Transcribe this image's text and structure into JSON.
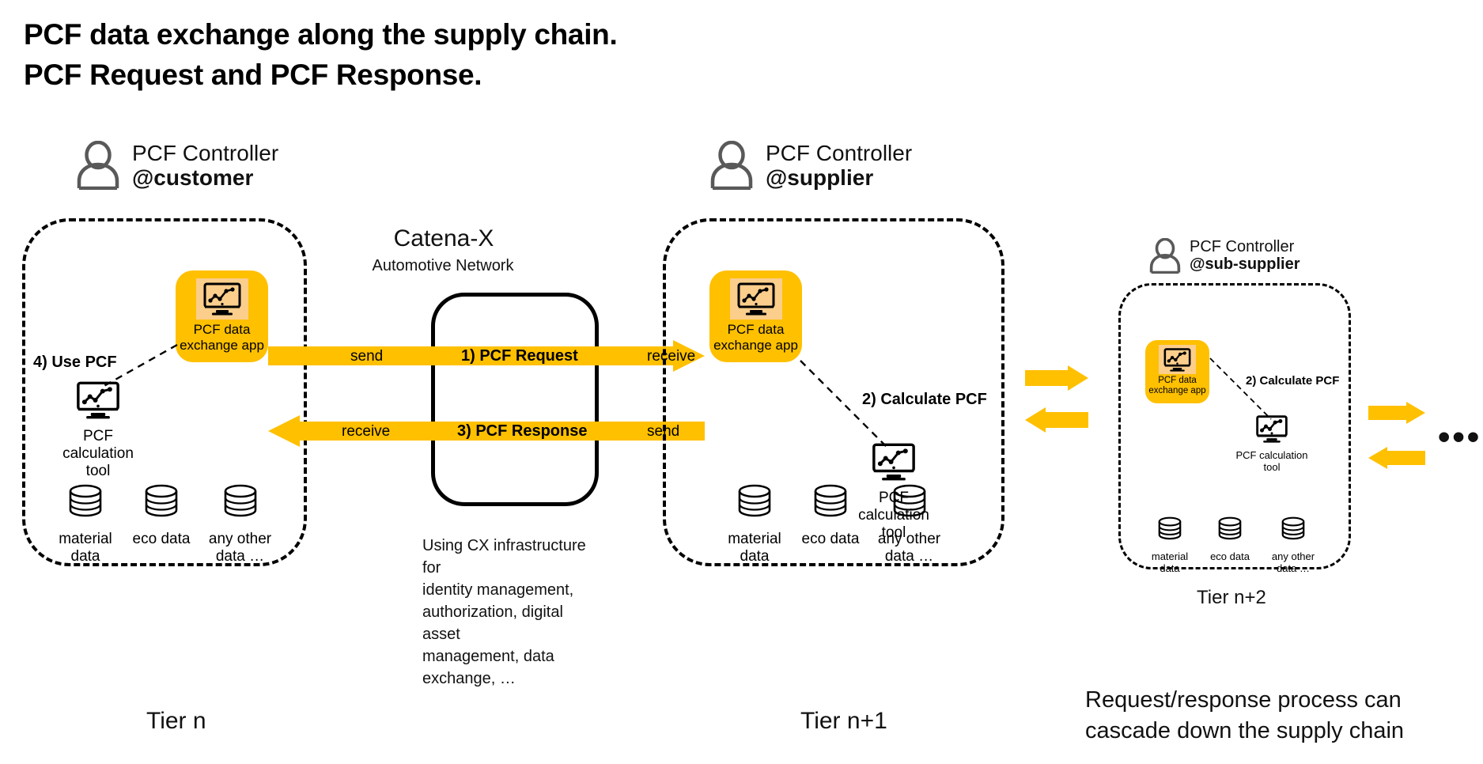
{
  "title": "PCF data exchange along the supply chain.\nPCF Request and PCF Response.",
  "customer": {
    "controller_role": "PCF Controller",
    "controller_handle": "@customer",
    "app": {
      "label": "PCF data\nexchange app",
      "icon": "monitor-chart-icon"
    },
    "calc_tool": {
      "label": "PCF\ncalculation\ntool",
      "icon": "monitor-chart-icon"
    },
    "step_label": "4) Use PCF",
    "databases": [
      {
        "label": "material\ndata",
        "icon": "database-icon"
      },
      {
        "label": "eco data",
        "icon": "database-icon"
      },
      {
        "label": "any other\ndata …",
        "icon": "database-icon"
      }
    ],
    "tier": "Tier n"
  },
  "network": {
    "title": "Catena-X",
    "subtitle": "Automotive Network",
    "note": "Using CX infrastructure for\nidentity management,\nauthorization, digital asset\nmanagement, data\nexchange, …"
  },
  "flows": [
    {
      "from_label": "send",
      "name": "1) PCF Request",
      "to_label": "receive",
      "direction": "right"
    },
    {
      "from_label": "receive",
      "name": "3) PCF Response",
      "to_label": "send",
      "direction": "left"
    }
  ],
  "supplier": {
    "controller_role": "PCF Controller",
    "controller_handle": "@supplier",
    "app": {
      "label": "PCF data\nexchange app",
      "icon": "monitor-chart-icon"
    },
    "calc_tool": {
      "label": "PCF\ncalculation\ntool",
      "icon": "monitor-chart-icon"
    },
    "step_label": "2) Calculate PCF",
    "databases": [
      {
        "label": "material\ndata",
        "icon": "database-icon"
      },
      {
        "label": "eco data",
        "icon": "database-icon"
      },
      {
        "label": "any other\ndata …",
        "icon": "database-icon"
      }
    ],
    "tier": "Tier n+1"
  },
  "subsupplier": {
    "controller_role": "PCF Controller",
    "controller_handle": "@sub-supplier",
    "app": {
      "label": "PCF data\nexchange app",
      "icon": "monitor-chart-icon"
    },
    "calc_tool": {
      "label": "PCF\ncalculation\ntool",
      "icon": "monitor-chart-icon"
    },
    "step_label": "2) Calculate PCF",
    "databases": [
      {
        "label": "material\ndata",
        "icon": "database-icon"
      },
      {
        "label": "eco data",
        "icon": "database-icon"
      },
      {
        "label": "any other\ndata …",
        "icon": "database-icon"
      }
    ],
    "tier": "Tier n+2"
  },
  "cascade_note": "Request/response process can\ncascade down the supply chain",
  "continuation_ellipsis": "•••",
  "colors": {
    "accent_yellow": "#FFC000",
    "icon_bg": "#FBCE8C",
    "person_gray": "#595959",
    "text_black": "#000000"
  }
}
